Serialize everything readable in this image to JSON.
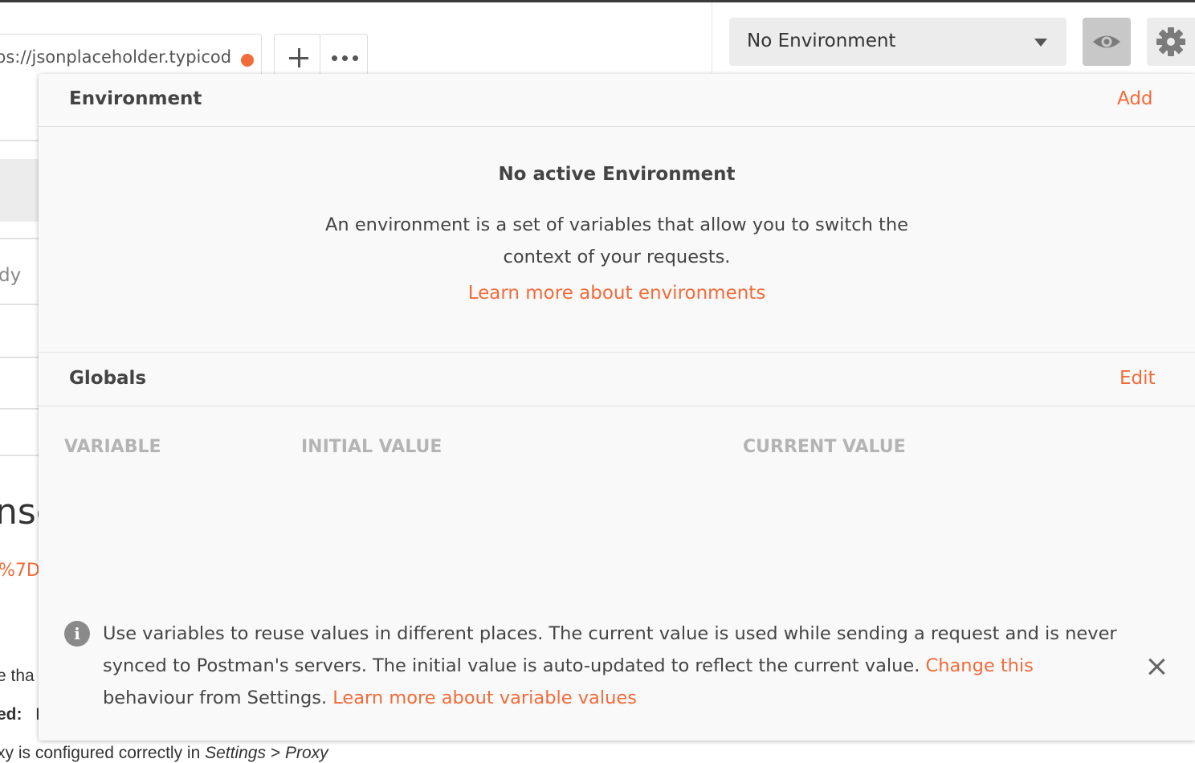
{
  "tab": {
    "url": "ps://jsonplaceholder.typicod"
  },
  "env_selector": {
    "selected": "No Environment"
  },
  "background": {
    "fragment_1": "dy",
    "fragment_2": "nse",
    "fragment_3": "%7D",
    "fragment_4": "e tha",
    "fragment_5": "ed:",
    "fragment_6": "I",
    "proxy_line_start": "xy is configured correctly in ",
    "proxy_settings": "Settings",
    "proxy_sep": " > ",
    "proxy_proxy": "Proxy"
  },
  "environment": {
    "title": "Environment",
    "add_label": "Add",
    "empty_title": "No active Environment",
    "empty_desc": "An environment is a set of variables that allow you to switch the context of your requests.",
    "learn_more": "Learn more about environments"
  },
  "globals": {
    "title": "Globals",
    "edit_label": "Edit",
    "columns": [
      "VARIABLE",
      "INITIAL VALUE",
      "CURRENT VALUE"
    ]
  },
  "info": {
    "text_1": "Use variables to reuse values in different places. The current value is used while sending a request and is never synced to Postman's servers. The initial value is auto-updated to reflect the current value. ",
    "link_change": "Change this",
    "text_2": " behaviour from Settings. ",
    "link_learn": "Learn more about variable values"
  },
  "colors": {
    "accent": "#f26b3a",
    "muted_header": "#b4b4b4"
  },
  "icons": [
    "plus-icon",
    "more-icon",
    "dropdown-caret-icon",
    "eye-icon",
    "gear-icon",
    "info-icon",
    "close-icon"
  ]
}
